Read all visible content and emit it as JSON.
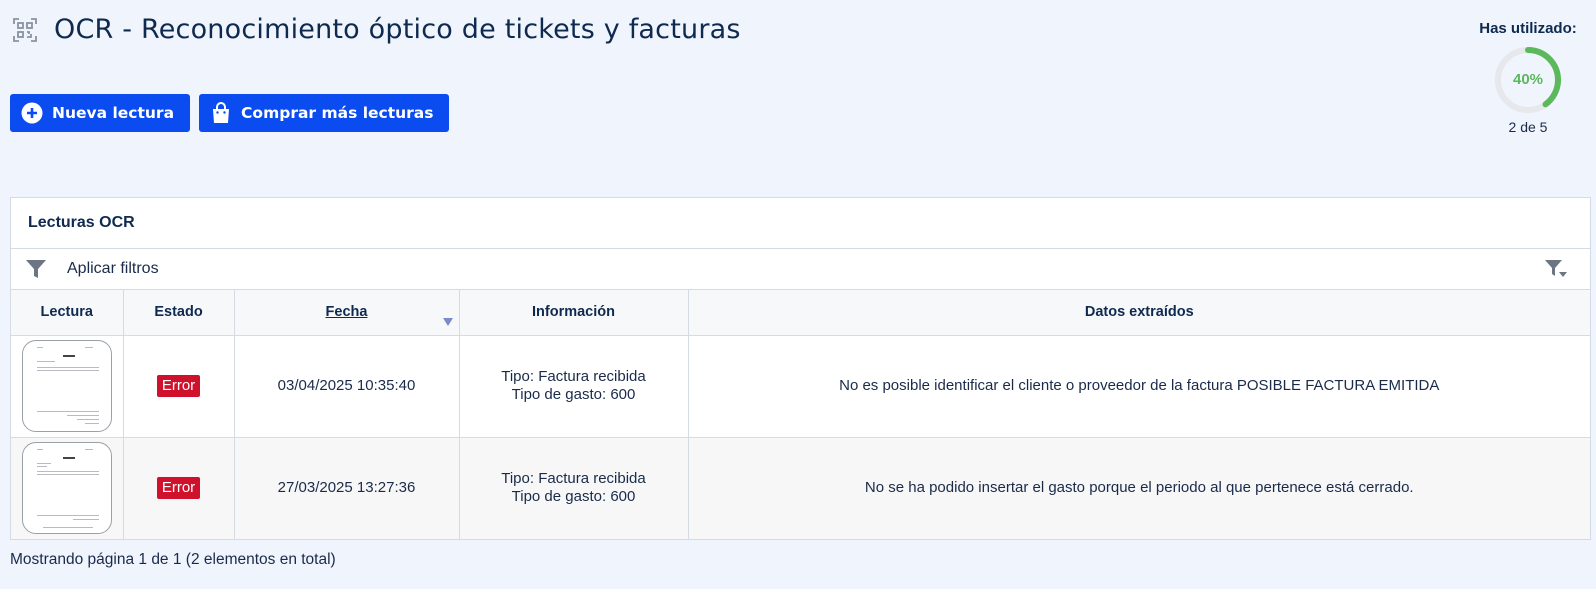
{
  "header": {
    "title": "OCR - Reconocimiento óptico de tickets y facturas",
    "icon": "ocr-scan-icon"
  },
  "actions": {
    "new_reading": "Nueva lectura",
    "buy_more": "Comprar más lecturas"
  },
  "usage": {
    "title": "Has utilizado:",
    "percent_label": "40%",
    "percent": 0.4,
    "count": "2 de 5",
    "color": "#5cb85c"
  },
  "panel": {
    "title": "Lecturas OCR",
    "filter_label": "Aplicar filtros"
  },
  "table": {
    "columns": {
      "lectura": "Lectura",
      "estado": "Estado",
      "fecha": "Fecha",
      "informacion": "Información",
      "datos": "Datos extraídos"
    },
    "rows": [
      {
        "estado": "Error",
        "fecha": "03/04/2025 10:35:40",
        "tipo": "Tipo: Factura recibida",
        "gasto": "Tipo de gasto: 600",
        "datos": "No es posible identificar el cliente o proveedor de la factura POSIBLE FACTURA EMITIDA"
      },
      {
        "estado": "Error",
        "fecha": "27/03/2025 13:27:36",
        "tipo": "Tipo: Factura recibida",
        "gasto": "Tipo de gasto: 600",
        "datos": "No se ha podido insertar el gasto porque el periodo al que pertenece está cerrado."
      }
    ]
  },
  "footer": {
    "pagination": "Mostrando página 1 de 1 (2 elementos en total)"
  },
  "colors": {
    "primary": "#0a4cf0",
    "error": "#d0112b",
    "background": "#eff4fd"
  }
}
